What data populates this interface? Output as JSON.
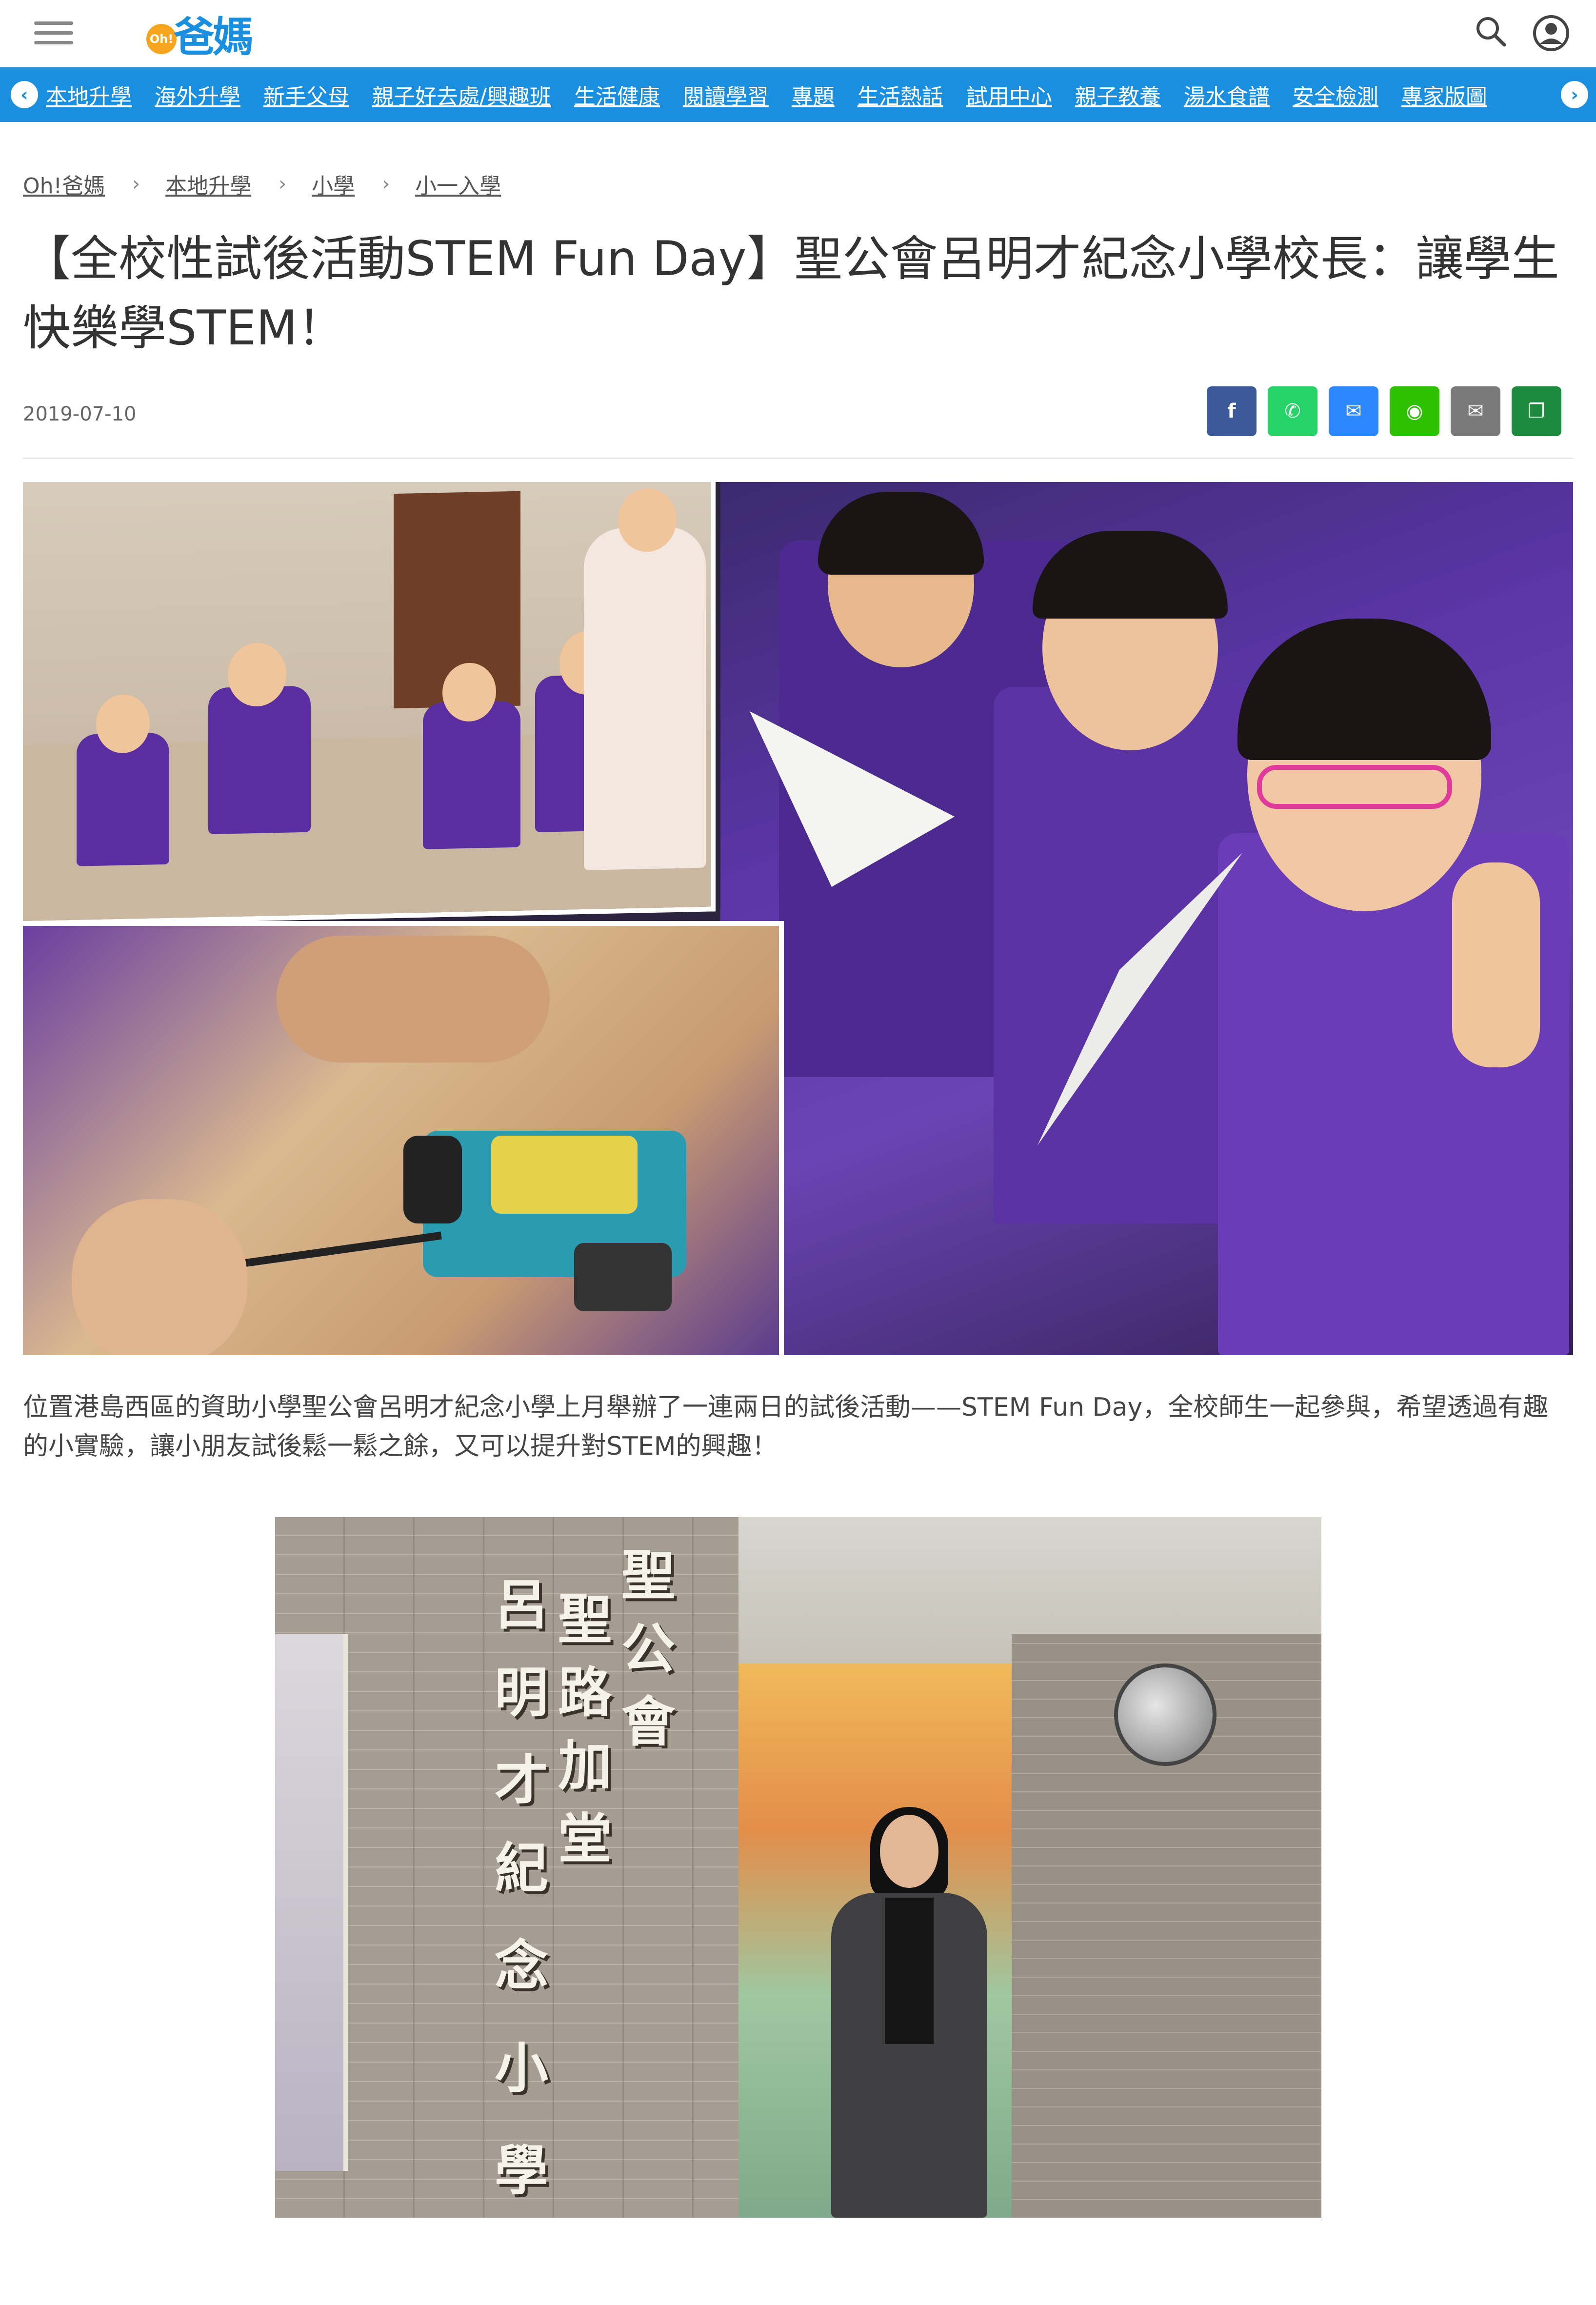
{
  "header": {
    "logo_badge": "Oh!",
    "logo_text": "爸媽",
    "icons": [
      "menu-icon",
      "search-icon",
      "user-icon"
    ]
  },
  "nav": {
    "items": [
      "本地升學",
      "海外升學",
      "新手父母",
      "親子好去處/興趣班",
      "生活健康",
      "閱讀學習",
      "專題",
      "生活熱話",
      "試用中心",
      "親子教養",
      "湯水食譜",
      "安全檢測",
      "專家版圖"
    ],
    "left_arrow": "‹",
    "right_arrow": "›"
  },
  "breadcrumb": {
    "items": [
      "Oh!爸媽",
      "本地升學",
      "小學",
      "小一入學"
    ],
    "separator": "›"
  },
  "article": {
    "title": "【全校性試後活動STEM Fun Day】聖公會呂明才紀念小學校長：讓學生快樂學STEM！",
    "date": "2019-07-10",
    "paragraph": "位置港島西區的資助小學聖公會呂明才紀念小學上月舉辦了一連兩日的試後活動——STEM Fun Day，全校師生一起參與，希望透過有趣的小實驗，讓小朋友試後鬆一鬆之餘，又可以提升對STEM的興趣！"
  },
  "share": {
    "buttons": [
      {
        "name": "facebook",
        "glyph": "f",
        "color": "#3b5998"
      },
      {
        "name": "whatsapp",
        "glyph": "✆",
        "color": "#25d366"
      },
      {
        "name": "messenger",
        "glyph": "✉",
        "color": "#2d88ff"
      },
      {
        "name": "wechat",
        "glyph": "◉",
        "color": "#2dc100"
      },
      {
        "name": "email",
        "glyph": "✉",
        "color": "#7a7a7a"
      },
      {
        "name": "copy",
        "glyph": "❐",
        "color": "#1e8a3e"
      }
    ]
  },
  "sign": {
    "chars": [
      "聖",
      "公",
      "會",
      "聖",
      "路",
      "加",
      "堂",
      "呂",
      "明",
      "才",
      "紀",
      "念",
      "小",
      "學"
    ]
  },
  "colors": {
    "brand_blue": "#1a8fe0",
    "logo_orange": "#f7a51c"
  }
}
